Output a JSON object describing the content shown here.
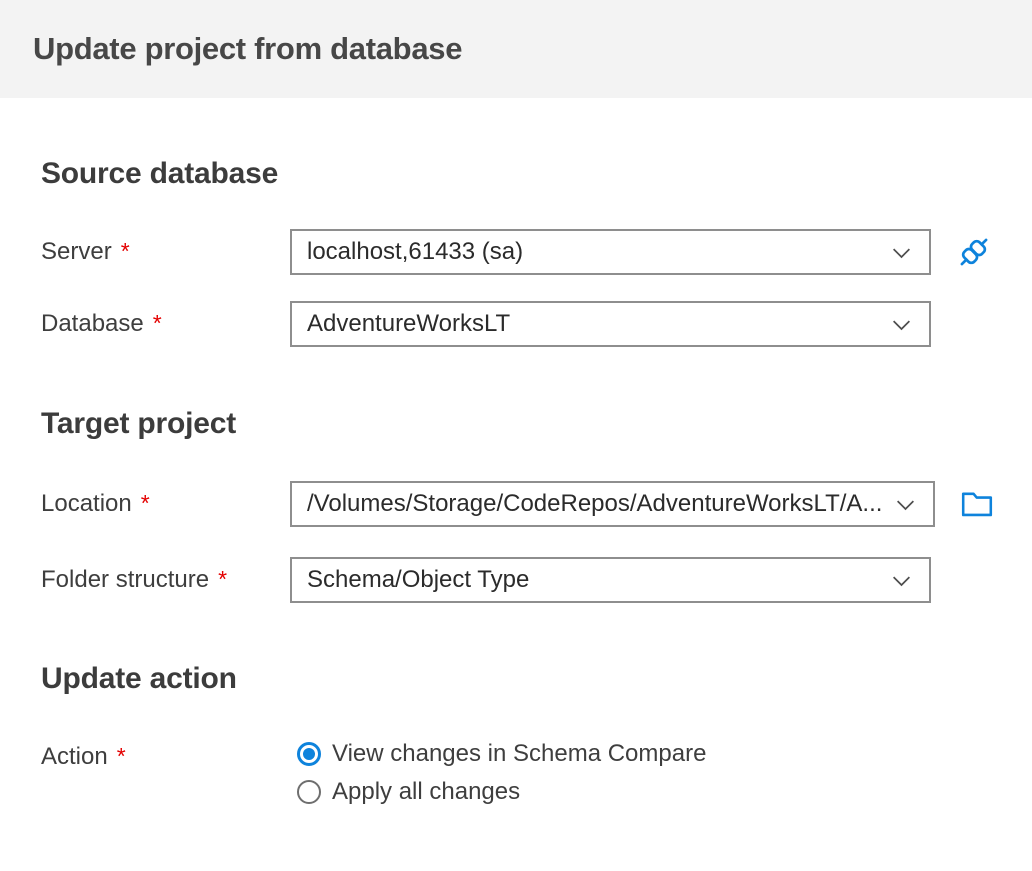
{
  "header": {
    "title": "Update project from database"
  },
  "required_marker": "*",
  "colors": {
    "accent": "#0e83dc",
    "required": "#e40000",
    "header_bg": "#f3f3f3",
    "border": "#8e8e8e"
  },
  "icons": {
    "server_action": "connect-plug-icon",
    "location_action": "folder-browse-icon",
    "dropdown": "chevron-down-icon"
  },
  "sections": {
    "source": {
      "heading": "Source database",
      "server": {
        "label": "Server",
        "value": "localhost,61433 (sa)"
      },
      "database": {
        "label": "Database",
        "value": "AdventureWorksLT"
      }
    },
    "target": {
      "heading": "Target project",
      "location": {
        "label": "Location",
        "value": "/Volumes/Storage/CodeRepos/AdventureWorksLT/A..."
      },
      "folder_structure": {
        "label": "Folder structure",
        "value": "Schema/Object Type"
      }
    },
    "update": {
      "heading": "Update action",
      "action": {
        "label": "Action",
        "options": [
          {
            "label": "View changes in Schema Compare",
            "selected": true
          },
          {
            "label": "Apply all changes",
            "selected": false
          }
        ]
      }
    }
  }
}
